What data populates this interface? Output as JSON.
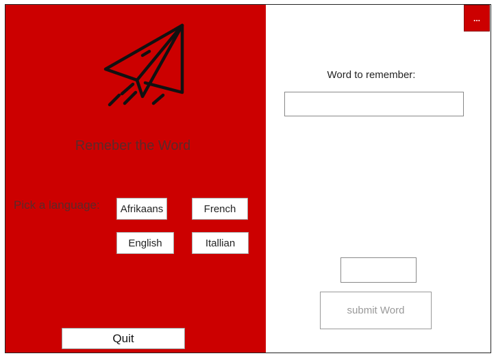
{
  "app": {
    "title": "Remeber the Word",
    "menu_label": "..."
  },
  "left": {
    "pick_label": "Pick a language:",
    "languages": [
      "Afrikaans",
      "French",
      "English",
      "Itallian"
    ],
    "quit_label": "Quit"
  },
  "right": {
    "word_label": "Word to remember:",
    "word_value": "",
    "small_value": "",
    "submit_label": "submit Word"
  },
  "colors": {
    "accent": "#cc0000"
  },
  "icons": {
    "logo": "paper-plane-icon"
  }
}
